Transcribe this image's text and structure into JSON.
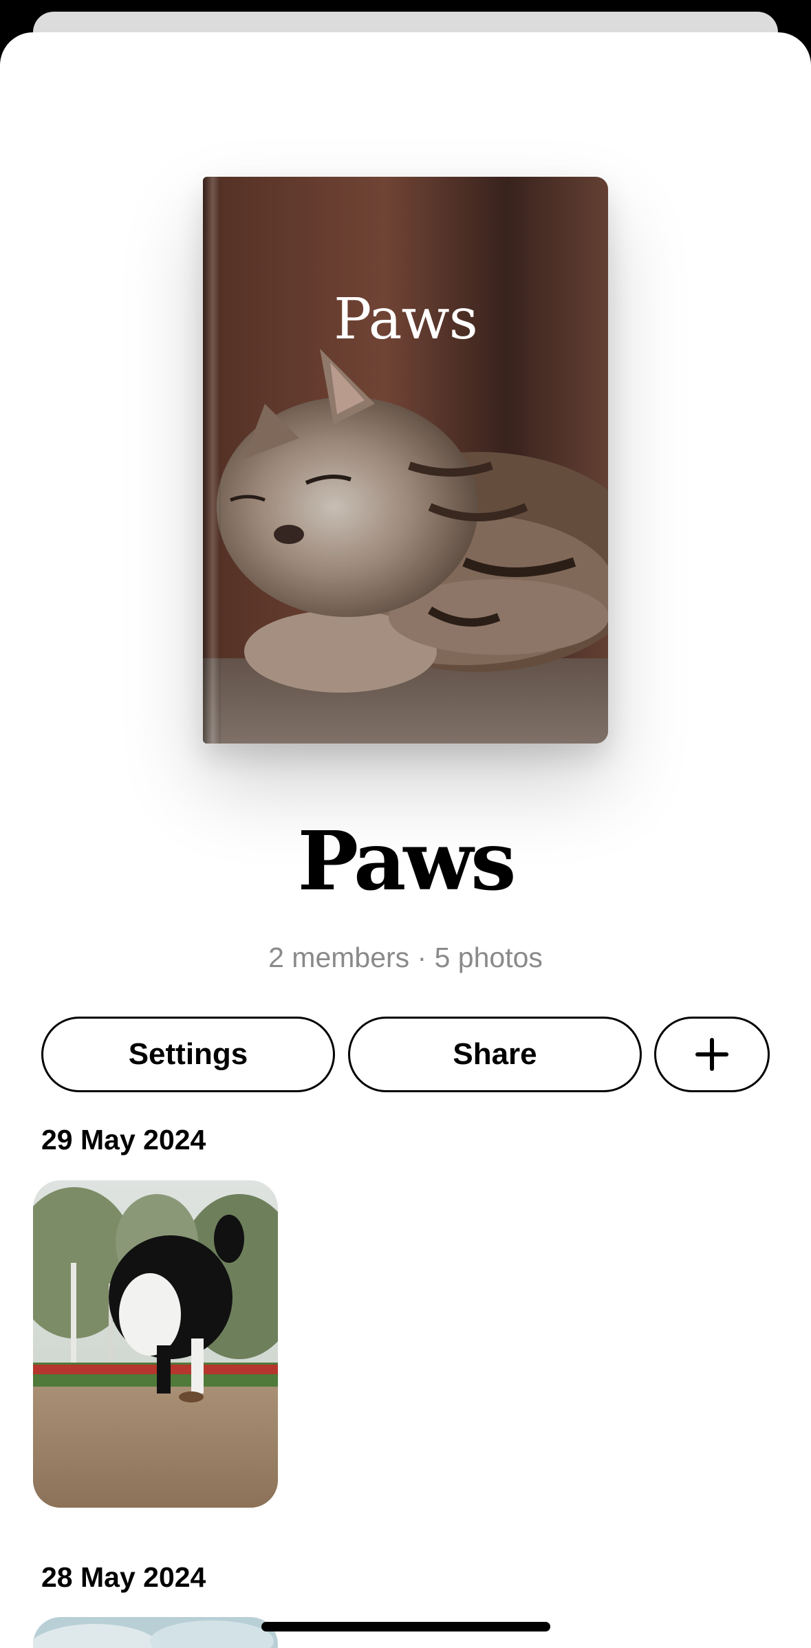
{
  "album": {
    "cover_title": "Paws",
    "title": "Paws",
    "meta": "2 members · 5 photos"
  },
  "actions": {
    "settings_label": "Settings",
    "share_label": "Share",
    "add_icon": "plus-icon"
  },
  "sections": [
    {
      "date": "29 May 2024",
      "photo": "dog-photo"
    },
    {
      "date": "28 May 2024",
      "photo": "sky-photo"
    }
  ]
}
